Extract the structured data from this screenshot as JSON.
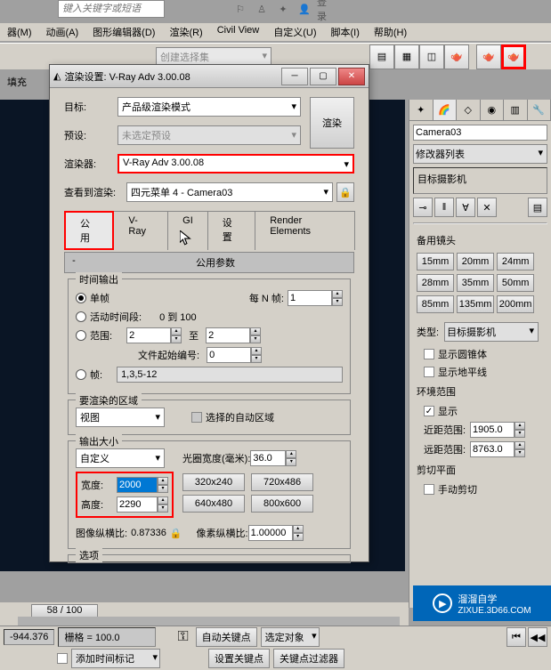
{
  "top": {
    "search_placeholder": "键入关键字或短语",
    "login": "登录"
  },
  "menu": {
    "m1": "器(M)",
    "anim": "动画(A)",
    "graph": "图形编辑器(D)",
    "render": "渲染(R)",
    "civil": "Civil View",
    "custom": "自定义(U)",
    "script": "脚本(I)",
    "help": "帮助(H)"
  },
  "toolbar": {
    "create_set": "创建选择集"
  },
  "fill": "填充",
  "dialog": {
    "title": "渲染设置: V-Ray Adv 3.00.08",
    "target_label": "目标:",
    "target_value": "产品级渲染模式",
    "preset_label": "预设:",
    "preset_value": "未选定预设",
    "renderer_label": "渲染器:",
    "renderer_value": "V-Ray Adv 3.00.08",
    "viewtorender_label": "查看到渲染:",
    "viewtorender_value": "四元菜单 4 - Camera03",
    "render_btn": "渲染",
    "tabs": {
      "common": "公用",
      "vray": "V-Ray",
      "gi": "GI",
      "settings": "设置",
      "elements": "Render Elements"
    },
    "panel_title": "公用参数",
    "time_output": "时间输出",
    "single": "单帧",
    "every_n": "每 N 帧:",
    "every_n_val": "1",
    "active": "活动时间段:",
    "active_range": "0 到 100",
    "range": "范围:",
    "range_from": "2",
    "range_to_label": "至",
    "range_to": "2",
    "file_start": "文件起始编号:",
    "file_start_val": "0",
    "frames": "帧:",
    "frames_val": "1,3,5-12",
    "area_title": "要渲染的区域",
    "area_value": "视图",
    "auto_region": "选择的自动区域",
    "output_size": "输出大小",
    "custom": "自定义",
    "aperture": "光圈宽度(毫米):",
    "aperture_val": "36.0",
    "width": "宽度:",
    "width_val": "2000",
    "height": "高度:",
    "height_val": "2290",
    "preset1": "320x240",
    "preset2": "720x486",
    "preset3": "640x480",
    "preset4": "800x600",
    "aspect": "图像纵横比:",
    "aspect_val": "0.87336",
    "pixel_aspect": "像素纵横比:",
    "pixel_aspect_val": "1.00000",
    "options": "选项"
  },
  "right": {
    "camera": "Camera03",
    "modlist": "修改器列表",
    "targetcam": "目标摄影机",
    "lens_title": "备用镜头",
    "lenses": [
      "15mm",
      "20mm",
      "24mm",
      "28mm",
      "35mm",
      "50mm",
      "85mm",
      "135mm",
      "200mm"
    ],
    "type_label": "类型:",
    "type_value": "目标摄影机",
    "show_cone": "显示圆锥体",
    "show_horizon": "显示地平线",
    "env_range": "环境范围",
    "show": "显示",
    "near": "近距范围:",
    "near_val": "1905.0",
    "far": "远距范围:",
    "far_val": "8763.0",
    "clip_plane": "剪切平面",
    "manual_clip": "手动剪切"
  },
  "timeline": {
    "pos": "58 / 100"
  },
  "bottom": {
    "coord": "-944.376",
    "grid": "栅格 = 100.0",
    "auto_key": "自动关键点",
    "sel_obj": "选定对象",
    "set_key": "设置关键点",
    "key_filter": "关键点过滤器",
    "add_marker": "添加时间标记"
  },
  "watermark": {
    "text": "溜溜自学",
    "sub": "ZIXUE.3D66.COM"
  }
}
